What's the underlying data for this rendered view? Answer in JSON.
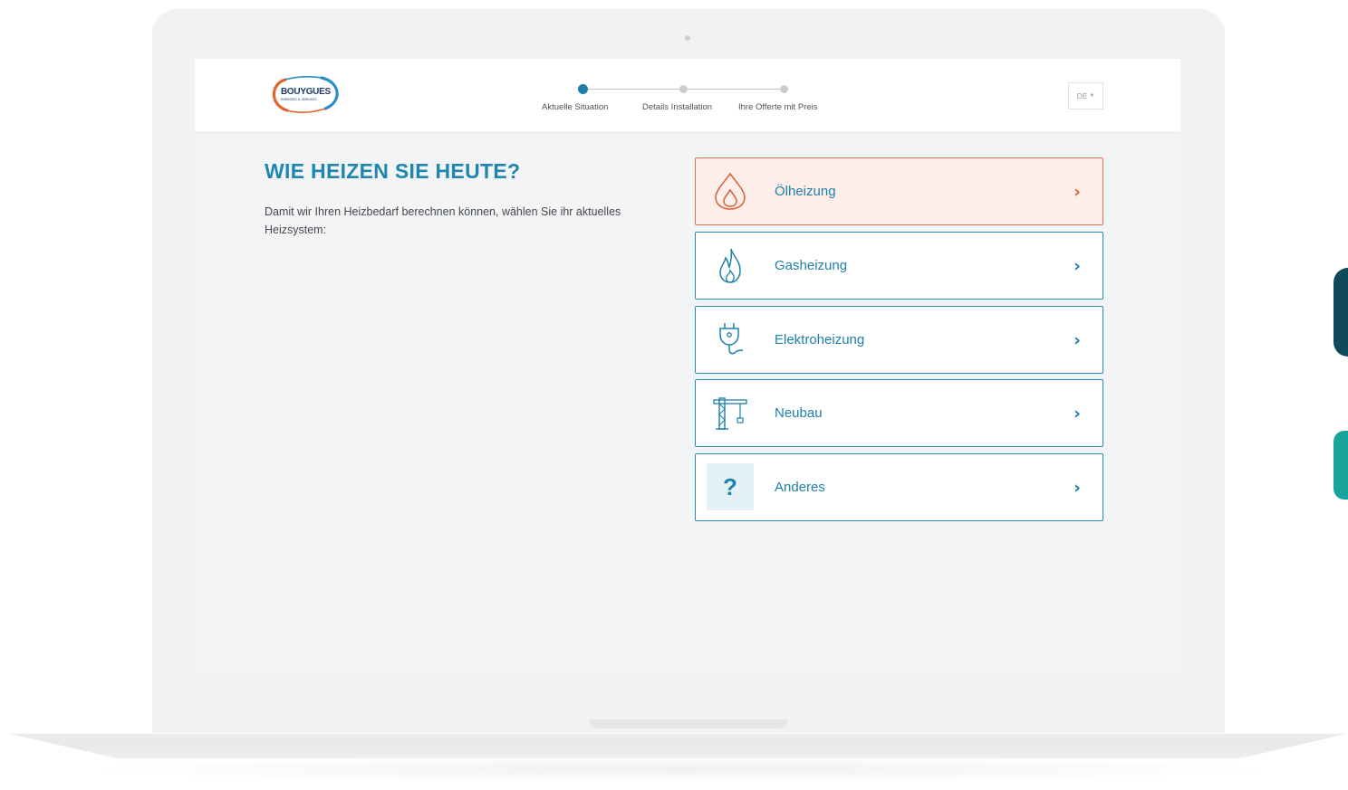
{
  "header": {
    "logo_text": "BOUYGUES",
    "logo_subtext": "ENERGIES & SERVICES",
    "steps": [
      {
        "label": "Aktuelle Situation",
        "active": true
      },
      {
        "label": "Details Installation",
        "active": false
      },
      {
        "label": "Ihre Offerte mit Preis",
        "active": false
      }
    ],
    "language": "DE"
  },
  "main": {
    "title": "WIE HEIZEN SIE HEUTE?",
    "description": "Damit wir Ihren Heizbedarf berechnen können, wählen Sie ihr aktuelles Heizsystem:",
    "options": [
      {
        "label": "Ölheizung",
        "icon": "oil-drop-icon",
        "selected": true
      },
      {
        "label": "Gasheizung",
        "icon": "flame-icon",
        "selected": false
      },
      {
        "label": "Elektroheizung",
        "icon": "plug-icon",
        "selected": false
      },
      {
        "label": "Neubau",
        "icon": "crane-icon",
        "selected": false
      },
      {
        "label": "Anderes",
        "icon": "question-icon",
        "selected": false
      }
    ]
  },
  "colors": {
    "accent": "#1e80ab",
    "selected_border": "#e0714b",
    "selected_bg": "#fdeee9",
    "side_tab_dark": "#10495c",
    "side_tab_teal": "#18a39a"
  }
}
